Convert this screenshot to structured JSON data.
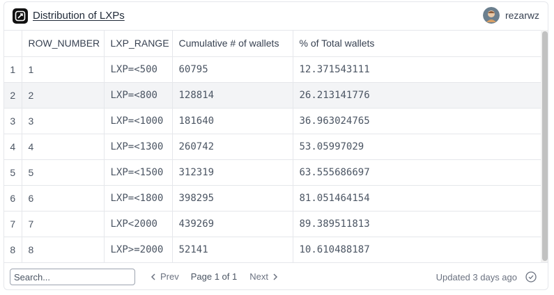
{
  "header": {
    "title": "Distribution of LXPs",
    "username": "rezarwz",
    "logo_icon": "flipside-logo-icon",
    "avatar_icon": "user-avatar-icon"
  },
  "table": {
    "columns": [
      "",
      "ROW_NUMBER",
      "LXP_RANGE",
      "Cumulative # of wallets",
      "% of Total wallets"
    ],
    "rows": [
      [
        "1",
        "1",
        "LXP=<500",
        "60795",
        "12.371543111"
      ],
      [
        "2",
        "2",
        "LXP=<800",
        "128814",
        "26.213141776"
      ],
      [
        "3",
        "3",
        "LXP=<1000",
        "181640",
        "36.963024765"
      ],
      [
        "4",
        "4",
        "LXP=<1300",
        "260742",
        "53.05997029"
      ],
      [
        "5",
        "5",
        "LXP=<1500",
        "312319",
        "63.555686697"
      ],
      [
        "6",
        "6",
        "LXP=<1800",
        "398295",
        "81.051464154"
      ],
      [
        "7",
        "7",
        "LXP<2000",
        "439269",
        "89.389511813"
      ],
      [
        "8",
        "8",
        "LXP>=2000",
        "52141",
        "10.610488187"
      ]
    ]
  },
  "footer": {
    "search_placeholder": "Search...",
    "prev_label": "Prev",
    "page_info": "Page 1 of 1",
    "next_label": "Next",
    "updated": "Updated 3 days ago",
    "status_icon": "check-circle-icon"
  },
  "colors": {
    "border": "#e5e7eb",
    "row_highlight": "#f3f4f6",
    "text": "#374151"
  }
}
